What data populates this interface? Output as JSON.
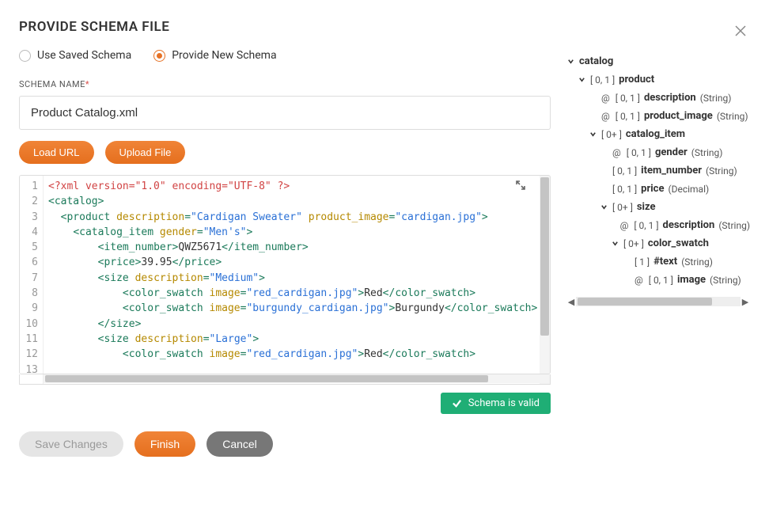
{
  "title": "PROVIDE SCHEMA FILE",
  "radios": {
    "saved": "Use Saved Schema",
    "provide": "Provide New Schema",
    "selected": "provide"
  },
  "schema_name": {
    "label": "SCHEMA NAME",
    "required_mark": "*",
    "value": "Product Catalog.xml"
  },
  "buttons": {
    "load_url": "Load URL",
    "upload_file": "Upload File",
    "save_changes": "Save Changes",
    "finish": "Finish",
    "cancel": "Cancel"
  },
  "status": {
    "valid": "Schema is valid"
  },
  "editor": {
    "line_numbers": [
      "1",
      "2",
      "3",
      "4",
      "5",
      "6",
      "7",
      "8",
      "9",
      "10",
      "11",
      "12",
      "13"
    ],
    "lines": [
      [
        {
          "c": "c-red",
          "t": "<?xml version=\"1.0\" encoding=\"UTF-8\" ?>"
        }
      ],
      [
        {
          "c": "c-tag",
          "t": "<catalog>"
        }
      ],
      [
        {
          "c": "",
          "t": "  "
        },
        {
          "c": "c-tag",
          "t": "<product "
        },
        {
          "c": "c-attr",
          "t": "description"
        },
        {
          "c": "c-tag",
          "t": "="
        },
        {
          "c": "c-str",
          "t": "\"Cardigan Sweater\""
        },
        {
          "c": "c-tag",
          "t": " "
        },
        {
          "c": "c-attr",
          "t": "product_image"
        },
        {
          "c": "c-tag",
          "t": "="
        },
        {
          "c": "c-str",
          "t": "\"cardigan.jpg\""
        },
        {
          "c": "c-tag",
          "t": ">"
        }
      ],
      [
        {
          "c": "",
          "t": "    "
        },
        {
          "c": "c-tag",
          "t": "<catalog_item "
        },
        {
          "c": "c-attr",
          "t": "gender"
        },
        {
          "c": "c-tag",
          "t": "="
        },
        {
          "c": "c-str",
          "t": "\"Men's\""
        },
        {
          "c": "c-tag",
          "t": ">"
        }
      ],
      [
        {
          "c": "",
          "t": "        "
        },
        {
          "c": "c-tag",
          "t": "<item_number>"
        },
        {
          "c": "c-txt",
          "t": "QWZ5671"
        },
        {
          "c": "c-tag",
          "t": "</item_number>"
        }
      ],
      [
        {
          "c": "",
          "t": "        "
        },
        {
          "c": "c-tag",
          "t": "<price>"
        },
        {
          "c": "c-txt",
          "t": "39.95"
        },
        {
          "c": "c-tag",
          "t": "</price>"
        }
      ],
      [
        {
          "c": "",
          "t": "        "
        },
        {
          "c": "c-tag",
          "t": "<size "
        },
        {
          "c": "c-attr",
          "t": "description"
        },
        {
          "c": "c-tag",
          "t": "="
        },
        {
          "c": "c-str",
          "t": "\"Medium\""
        },
        {
          "c": "c-tag",
          "t": ">"
        }
      ],
      [
        {
          "c": "",
          "t": "            "
        },
        {
          "c": "c-tag",
          "t": "<color_swatch "
        },
        {
          "c": "c-attr",
          "t": "image"
        },
        {
          "c": "c-tag",
          "t": "="
        },
        {
          "c": "c-str",
          "t": "\"red_cardigan.jpg\""
        },
        {
          "c": "c-tag",
          "t": ">"
        },
        {
          "c": "c-txt",
          "t": "Red"
        },
        {
          "c": "c-tag",
          "t": "</color_swatch>"
        }
      ],
      [
        {
          "c": "",
          "t": "            "
        },
        {
          "c": "c-tag",
          "t": "<color_swatch "
        },
        {
          "c": "c-attr",
          "t": "image"
        },
        {
          "c": "c-tag",
          "t": "="
        },
        {
          "c": "c-str",
          "t": "\"burgundy_cardigan.jpg\""
        },
        {
          "c": "c-tag",
          "t": ">"
        },
        {
          "c": "c-txt",
          "t": "Burgundy"
        },
        {
          "c": "c-tag",
          "t": "</color_swatch>"
        }
      ],
      [
        {
          "c": "",
          "t": "        "
        },
        {
          "c": "c-tag",
          "t": "</size>"
        }
      ],
      [
        {
          "c": "",
          "t": "        "
        },
        {
          "c": "c-tag",
          "t": "<size "
        },
        {
          "c": "c-attr",
          "t": "description"
        },
        {
          "c": "c-tag",
          "t": "="
        },
        {
          "c": "c-str",
          "t": "\"Large\""
        },
        {
          "c": "c-tag",
          "t": ">"
        }
      ],
      [
        {
          "c": "",
          "t": "            "
        },
        {
          "c": "c-tag",
          "t": "<color_swatch "
        },
        {
          "c": "c-attr",
          "t": "image"
        },
        {
          "c": "c-tag",
          "t": "="
        },
        {
          "c": "c-str",
          "t": "\"red_cardigan.jpg\""
        },
        {
          "c": "c-tag",
          "t": ">"
        },
        {
          "c": "c-txt",
          "t": "Red"
        },
        {
          "c": "c-tag",
          "t": "</color_swatch>"
        }
      ],
      []
    ]
  },
  "tree": [
    {
      "indent": 0,
      "chev": "down",
      "prefix": "",
      "card": "",
      "name": "catalog",
      "type": ""
    },
    {
      "indent": 1,
      "chev": "down",
      "prefix": "",
      "card": "[ 0, 1 ]",
      "name": "product",
      "type": ""
    },
    {
      "indent": 2,
      "chev": "",
      "prefix": "@",
      "card": "[ 0, 1 ]",
      "name": "description",
      "type": "(String)"
    },
    {
      "indent": 2,
      "chev": "",
      "prefix": "@",
      "card": "[ 0, 1 ]",
      "name": "product_image",
      "type": "(String)"
    },
    {
      "indent": 2,
      "chev": "down",
      "prefix": "",
      "card": "[ 0+ ]",
      "name": "catalog_item",
      "type": ""
    },
    {
      "indent": 3,
      "chev": "",
      "prefix": "@",
      "card": "[ 0, 1 ]",
      "name": "gender",
      "type": "(String)"
    },
    {
      "indent": 3,
      "chev": "",
      "prefix": "",
      "card": "[ 0, 1 ]",
      "name": "item_number",
      "type": "(String)"
    },
    {
      "indent": 3,
      "chev": "",
      "prefix": "",
      "card": "[ 0, 1 ]",
      "name": "price",
      "type": "(Decimal)"
    },
    {
      "indent": 3,
      "chev": "down",
      "prefix": "",
      "card": "[ 0+ ]",
      "name": "size",
      "type": ""
    },
    {
      "indent": 4,
      "chev": "",
      "prefix": "@",
      "card": "[ 0, 1 ]",
      "name": "description",
      "type": "(String)"
    },
    {
      "indent": 4,
      "chev": "down",
      "prefix": "",
      "card": "[ 0+ ]",
      "name": "color_swatch",
      "type": ""
    },
    {
      "indent": 4,
      "chev": "",
      "prefix": "",
      "card": "[ 1 ]",
      "name": "#text",
      "type": "(String)",
      "extra": 1
    },
    {
      "indent": 4,
      "chev": "",
      "prefix": "@",
      "card": "[ 0, 1 ]",
      "name": "image",
      "type": "(String)",
      "extra": 1
    }
  ]
}
